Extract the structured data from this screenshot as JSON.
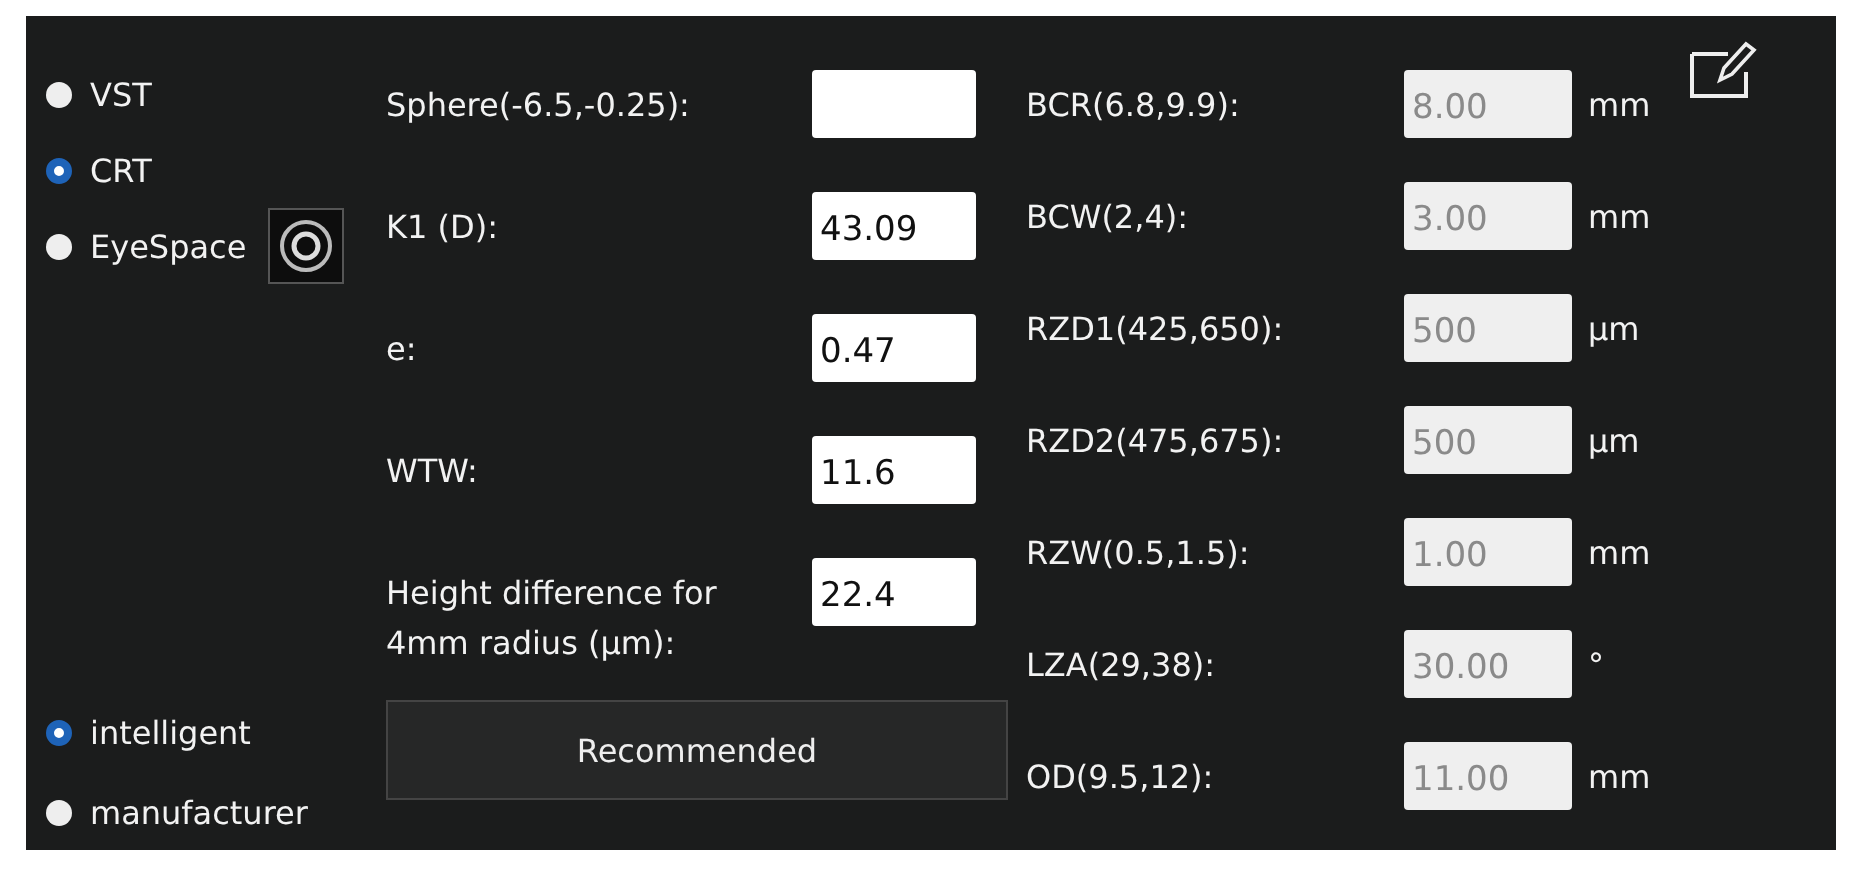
{
  "lens_types": [
    {
      "label": "VST",
      "selected": false
    },
    {
      "label": "CRT",
      "selected": true
    },
    {
      "label": "EyeSpace",
      "selected": false
    }
  ],
  "inputs": [
    {
      "label": "Sphere(-6.5,-0.25):"
    },
    {
      "label": "K1 (D):",
      "value": "43.09"
    },
    {
      "label": "e:",
      "value": "0.47"
    },
    {
      "label": "WTW:",
      "value": "11.6"
    },
    {
      "label": "Height difference for 4mm radius (μm):",
      "value": "22.4"
    }
  ],
  "modes": [
    {
      "label": "intelligent",
      "selected": true
    },
    {
      "label": "manufacturer",
      "selected": false
    }
  ],
  "recommend_button": "Recommended",
  "parameters": [
    {
      "label": "BCR(6.8,9.9):",
      "value": "8.00",
      "unit": "mm",
      "disabled": true
    },
    {
      "label": "BCW(2,4):",
      "value": "3.00",
      "unit": "mm",
      "disabled": true
    },
    {
      "label": "RZD1(425,650):",
      "value": "500",
      "unit": "μm",
      "disabled": true
    },
    {
      "label": "RZD2(475,675):",
      "value": "500",
      "unit": "μm",
      "disabled": true
    },
    {
      "label": "RZW(0.5,1.5):",
      "value": "1.00",
      "unit": "mm",
      "disabled": true
    },
    {
      "label": "LZA(29,38):",
      "value": "30.00",
      "unit": "°",
      "disabled": true
    },
    {
      "label": "OD(9.5,12):",
      "value": "11.00",
      "unit": "mm",
      "disabled": true
    }
  ]
}
